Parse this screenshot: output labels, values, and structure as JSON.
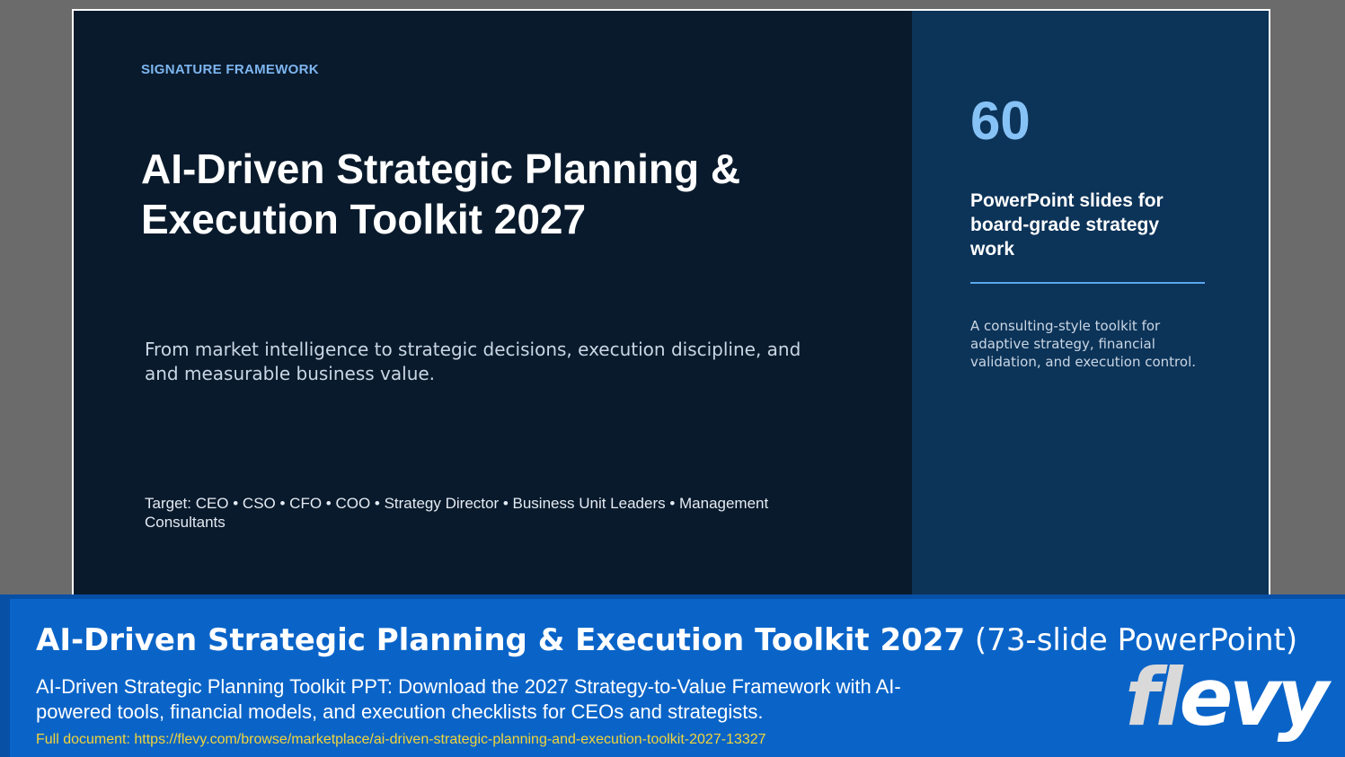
{
  "slide": {
    "eyebrow": "SIGNATURE FRAMEWORK",
    "title": "AI-Driven Strategic Planning & Execution Toolkit 2027",
    "subtitle": "From market intelligence to strategic decisions, execution discipline, and and measurable business value.",
    "target": "Target: CEO • CSO • CFO • COO • Strategy Director • Business Unit Leaders • Management Consultants",
    "stat_number": "60",
    "stat_label": "PowerPoint slides for board-grade strategy work",
    "stat_description": "A consulting-style toolkit for adaptive strategy, financial validation, and execution control."
  },
  "banner": {
    "title_bold": "AI-Driven Strategic Planning & Execution Toolkit 2027",
    "title_suffix": "(73-slide PowerPoint)",
    "description": "AI-Driven Strategic Planning Toolkit PPT: Download the 2027 Strategy-to-Value Framework with AI-powered tools, financial models, and execution checklists for CEOs and strategists.",
    "link": "Full document: https://flevy.com/browse/marketplace/ai-driven-strategic-planning-and-execution-toolkit-2027-13327",
    "logo_first": "fl",
    "logo_rest": "evy"
  },
  "colors": {
    "slide_dark": "#091a2c",
    "slide_panel": "#0c3358",
    "accent_blue": "#86c2f5",
    "banner_blue": "#0a64c8",
    "link_yellow": "#f2d43a"
  }
}
